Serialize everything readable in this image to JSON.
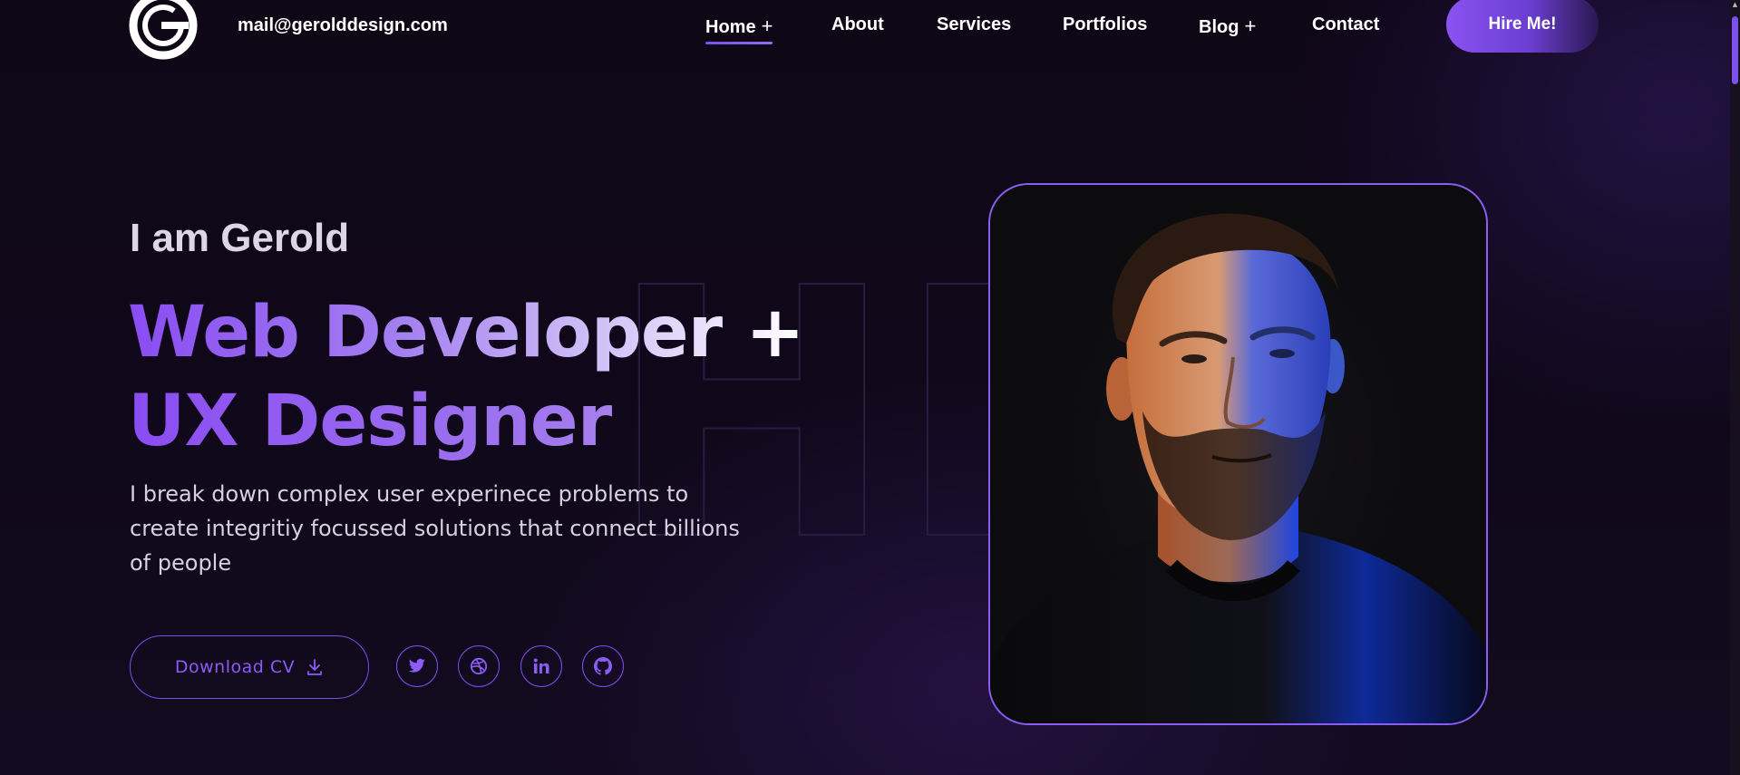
{
  "header": {
    "email": "mail@gerolddesign.com",
    "nav": [
      {
        "label": "Home",
        "has_submenu": true,
        "active": true
      },
      {
        "label": "About",
        "has_submenu": false
      },
      {
        "label": "Services",
        "has_submenu": false
      },
      {
        "label": "Portfolios",
        "has_submenu": false
      },
      {
        "label": "Blog",
        "has_submenu": true
      },
      {
        "label": "Contact",
        "has_submenu": false
      }
    ],
    "submenu_icon": "+",
    "hire_label": "Hire Me!"
  },
  "hero": {
    "intro": "I am Gerold",
    "headline_line1": "Web Developer +",
    "headline_line2": "UX Designer",
    "description": "I break down complex user experinece problems to create integritiy focussed solutions that connect billions of people",
    "download_label": "Download CV",
    "background_outline_text": "HI",
    "socials": [
      {
        "name": "twitter-icon"
      },
      {
        "name": "dribbble-icon"
      },
      {
        "name": "linkedin-icon"
      },
      {
        "name": "github-icon"
      }
    ]
  },
  "colors": {
    "accent": "#8b5cf6",
    "background": "#0f0817",
    "border": "#7d4ef0"
  }
}
